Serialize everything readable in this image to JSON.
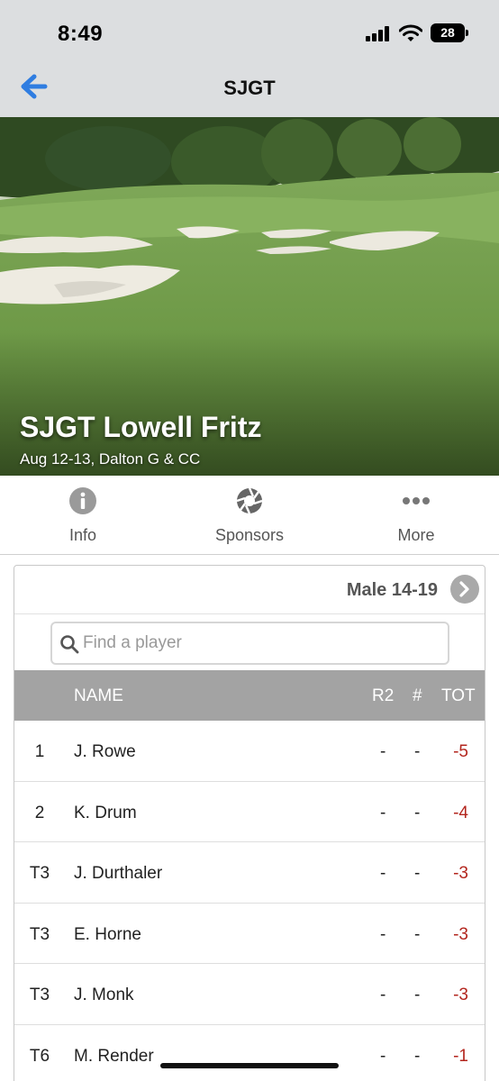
{
  "status_bar": {
    "time": "8:49",
    "battery": "28"
  },
  "nav": {
    "title": "SJGT"
  },
  "event": {
    "title": "SJGT Lowell Fritz",
    "subtitle": "Aug 12-13, Dalton G & CC"
  },
  "tabs": [
    {
      "label": "Info",
      "icon": "info-icon"
    },
    {
      "label": "Sponsors",
      "icon": "aperture-icon"
    },
    {
      "label": "More",
      "icon": "more-dots-icon"
    }
  ],
  "leaderboard": {
    "division": "Male 14-19",
    "search_placeholder": "Find a player",
    "columns": {
      "name": "NAME",
      "r2": "R2",
      "hole": "#",
      "tot": "TOT"
    },
    "rows": [
      {
        "pos": "1",
        "name": "J. Rowe",
        "r2": "-",
        "hole": "-",
        "tot": "-5"
      },
      {
        "pos": "2",
        "name": "K. Drum",
        "r2": "-",
        "hole": "-",
        "tot": "-4"
      },
      {
        "pos": "T3",
        "name": "J. Durthaler",
        "r2": "-",
        "hole": "-",
        "tot": "-3"
      },
      {
        "pos": "T3",
        "name": "E. Horne",
        "r2": "-",
        "hole": "-",
        "tot": "-3"
      },
      {
        "pos": "T3",
        "name": "J. Monk",
        "r2": "-",
        "hole": "-",
        "tot": "-3"
      },
      {
        "pos": "T6",
        "name": "M. Render",
        "r2": "-",
        "hole": "-",
        "tot": "-1"
      }
    ]
  },
  "colors": {
    "accent": "#2f7de1",
    "score_under_par": "#b3261e",
    "header_gray": "#a3a3a3"
  }
}
